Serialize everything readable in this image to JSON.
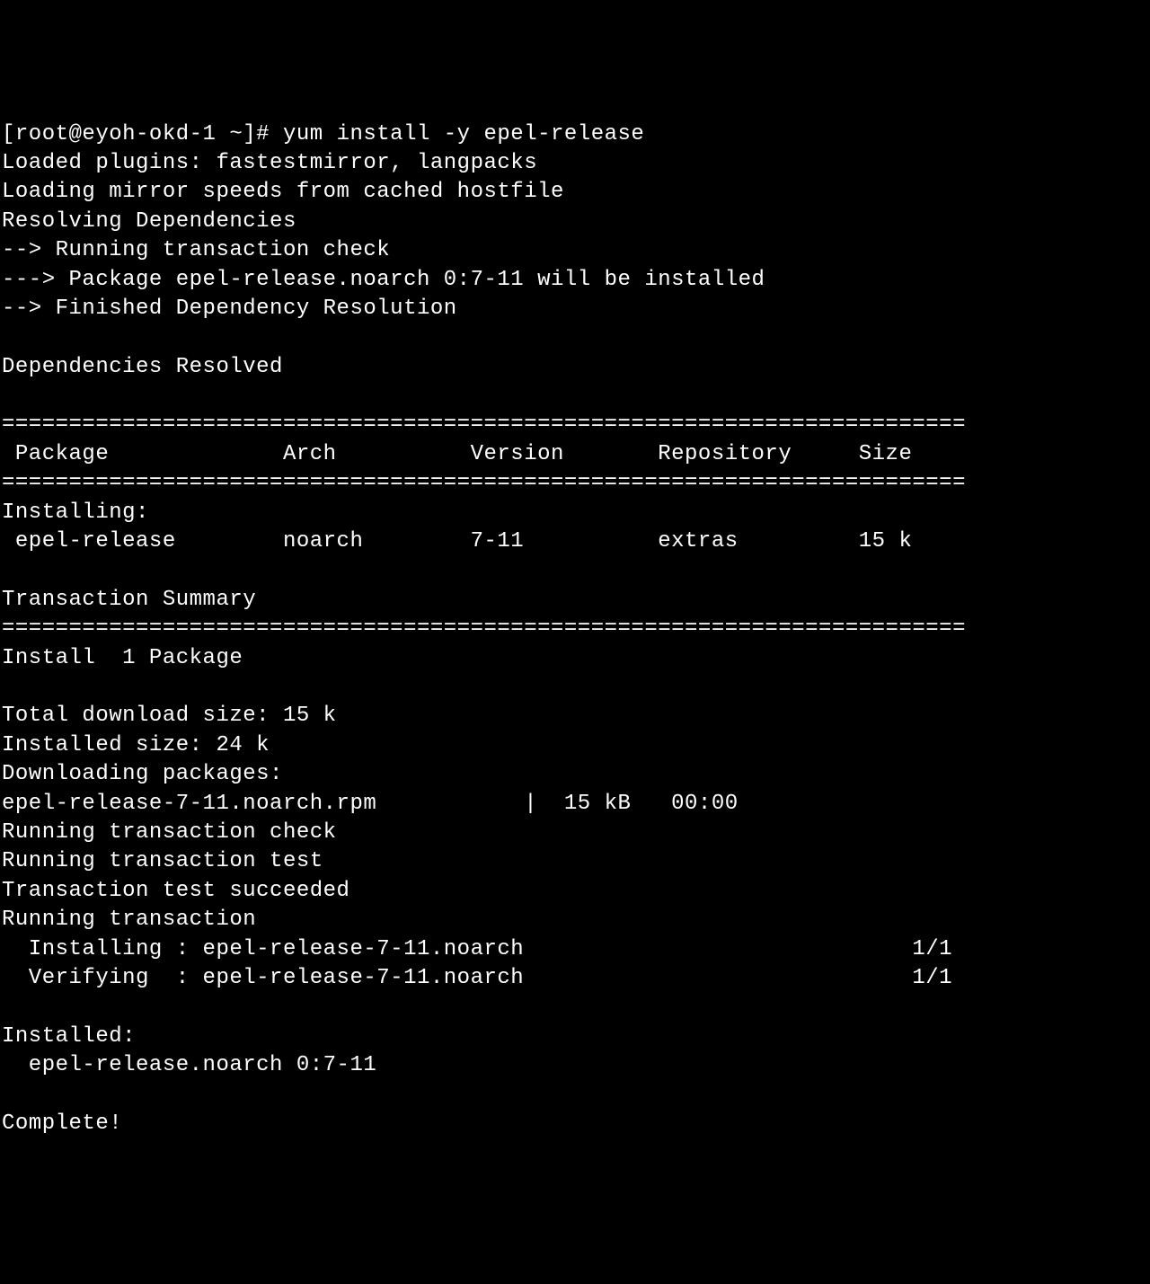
{
  "prompt": "[root@eyoh-okd-1 ~]# ",
  "command": "yum install -y epel-release",
  "lines": {
    "loaded_plugins": "Loaded plugins: fastestmirror, langpacks",
    "loading_mirror": "Loading mirror speeds from cached hostfile",
    "resolving_deps": "Resolving Dependencies",
    "running_tx_check": "--> Running transaction check",
    "package_will_install": "---> Package epel-release.noarch 0:7-11 will be installed",
    "finished_dep_res": "--> Finished Dependency Resolution",
    "deps_resolved": "Dependencies Resolved",
    "divider": "========================================================================",
    "header": " Package             Arch          Version       Repository     Size",
    "installing_label": "Installing:",
    "pkg_row": " epel-release        noarch        7-11          extras         15 k",
    "tx_summary": "Transaction Summary",
    "install_count": "Install  1 Package",
    "total_dl": "Total download size: 15 k",
    "installed_size": "Installed size: 24 k",
    "downloading": "Downloading packages:",
    "rpm_line": "epel-release-7-11.noarch.rpm           |  15 kB   00:00",
    "running_tx_check2": "Running transaction check",
    "running_tx_test": "Running transaction test",
    "tx_test_succeeded": "Transaction test succeeded",
    "running_tx": "Running transaction",
    "installing_step": "  Installing : epel-release-7-11.noarch                             1/1",
    "verifying_step": "  Verifying  : epel-release-7-11.noarch                             1/1",
    "installed_label": "Installed:",
    "installed_pkg": "  epel-release.noarch 0:7-11",
    "complete": "Complete!"
  }
}
